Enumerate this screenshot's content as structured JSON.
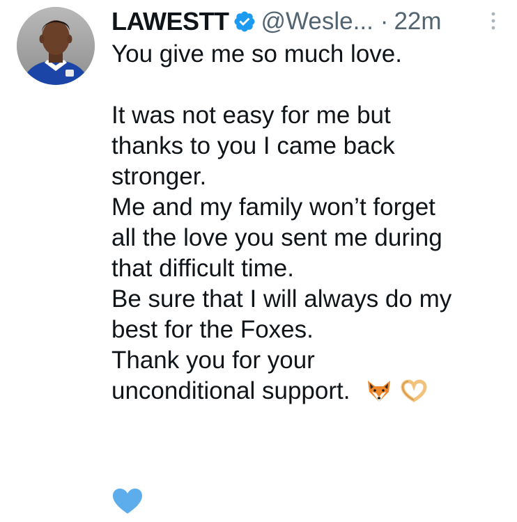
{
  "tweet": {
    "display_name": "LAWESTT",
    "handle": "@Wesle...",
    "separator": "·",
    "time": "22m",
    "text_lines": [
      "You give me so much love.",
      "",
      "It was not easy for me but",
      "thanks to you I came back",
      "stronger.",
      "Me and my family won’t forget",
      "all the love you sent me during",
      "that difficult time.",
      "Be sure that I will always do my",
      "best for the Foxes.",
      "Thank you for your",
      "unconditional support."
    ],
    "trailing_emojis": [
      "fox-face-emoji",
      "heart-hands-emoji"
    ],
    "final_emoji": "blue-heart-emoji",
    "icons": {
      "verified": "verified-badge-icon",
      "more": "more-options-icon"
    }
  },
  "colors": {
    "verified_blue": "#1d9bf0",
    "text": "#0f1419",
    "secondary": "#536471",
    "heart_blue": "#5dadec"
  }
}
